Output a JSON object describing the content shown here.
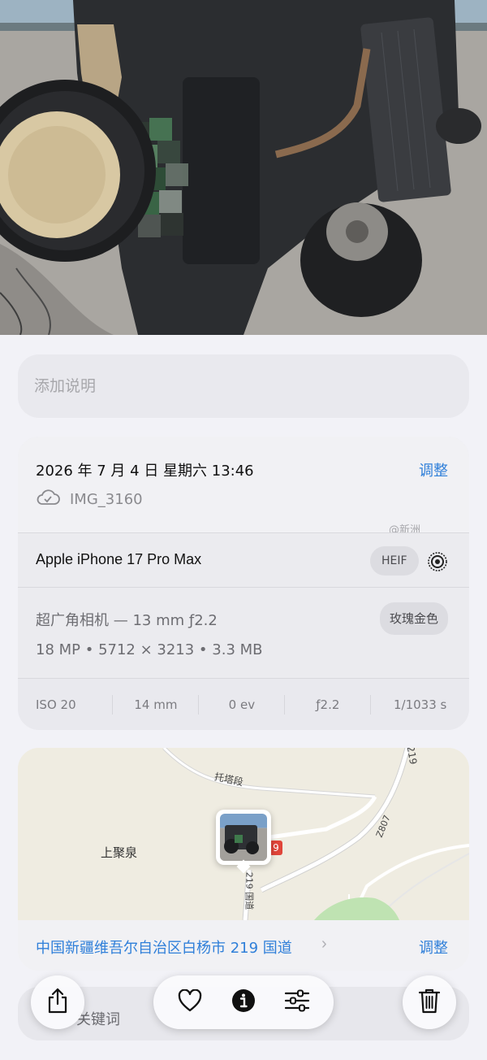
{
  "caption": {
    "placeholder": "添加说明"
  },
  "info": {
    "date": "2026 年 7 月 4 日 星期六 13:46",
    "adjust_label": "调整",
    "filename": "IMG_3160",
    "watermark": "@新洲",
    "device": "Apple iPhone 17 Pro Max",
    "format": "HEIF",
    "lens": "超广角相机 — 13 mm ƒ2.2",
    "specs": "18 MP • 5712 × 3213 • 3.3 MB",
    "color": "玫瑰金色",
    "exif": [
      "ISO 20",
      "14 mm",
      "0 ev",
      "ƒ2.2",
      "1/1033 s"
    ]
  },
  "map": {
    "labels": {
      "road_tuota": "托塔段",
      "road_219_top": "219",
      "road_z807": "Z807",
      "road_219_vertical": "219 国道",
      "road_badge": "9",
      "place": "上聚泉"
    },
    "location": "中国新疆维吾尔自治区白杨市 219 国道",
    "location_chevron": "›",
    "adjust_label": "调整"
  },
  "keywords": {
    "label": "添加关键词",
    "visible_label": "关键词"
  },
  "toolbar": {
    "icons": [
      "share-icon",
      "heart-icon",
      "info-icon",
      "sliders-icon",
      "trash-icon"
    ]
  },
  "colors": {
    "accent": "#2f7fd9",
    "card": "#e9e9ee",
    "background": "#f2f2f7"
  }
}
